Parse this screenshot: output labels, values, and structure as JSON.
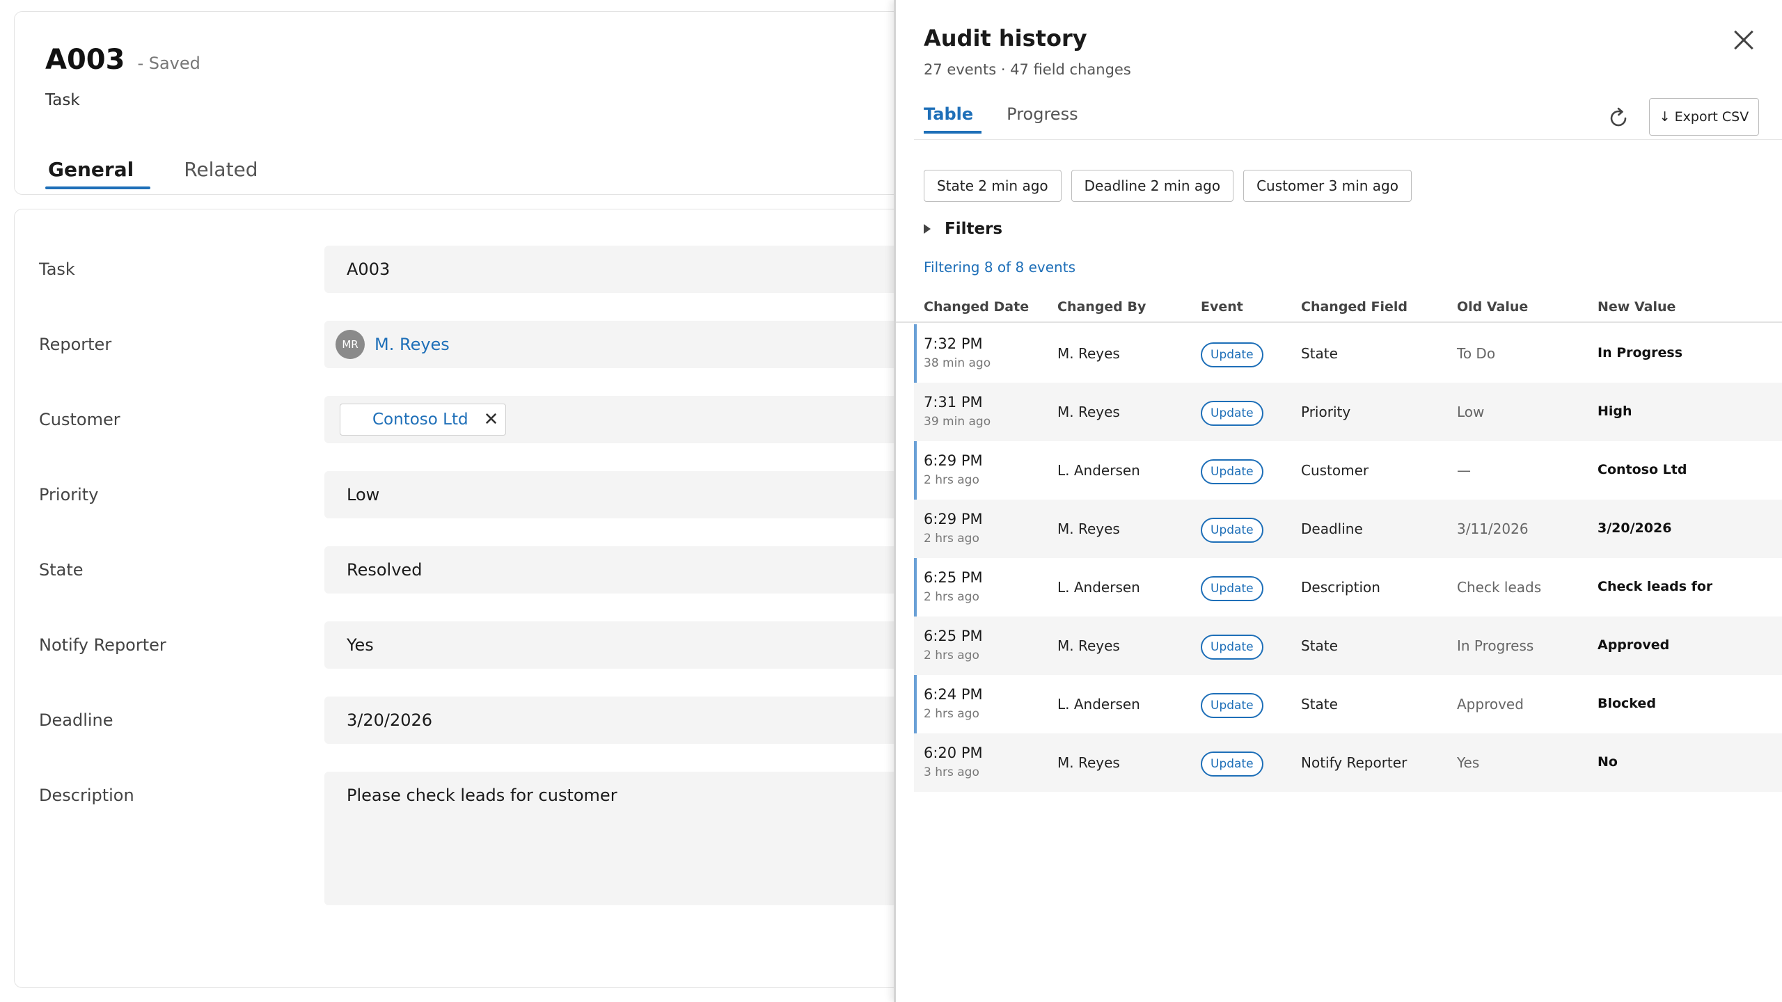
{
  "record": {
    "title": "A003",
    "status": "- Saved",
    "type": "Task",
    "tabs": [
      {
        "label": "General",
        "active": true
      },
      {
        "label": "Related",
        "active": false
      }
    ]
  },
  "form": {
    "fields": [
      {
        "label": "Task",
        "value": "A003"
      },
      {
        "label": "Reporter",
        "value": "M. Reyes",
        "avatar_initials": "MR"
      },
      {
        "label": "Customer",
        "value": "Contoso Ltd"
      },
      {
        "label": "Priority",
        "value": "Low"
      },
      {
        "label": "State",
        "value": "Resolved"
      },
      {
        "label": "Notify Reporter",
        "value": "Yes"
      },
      {
        "label": "Deadline",
        "value": "3/20/2026"
      },
      {
        "label": "Description",
        "value": "Please check leads for customer"
      }
    ]
  },
  "panel": {
    "title": "Audit history",
    "subtitle": "27 events · 47 field changes",
    "tabs": [
      {
        "label": "Table",
        "active": true
      },
      {
        "label": "Progress",
        "active": false
      }
    ],
    "export_label": "Export CSV",
    "chips": [
      "State 2 min ago",
      "Deadline 2 min ago",
      "Customer 3 min ago"
    ],
    "filters_label": "Filters",
    "filter_count": "Filtering 8 of 8 events",
    "columns": [
      "Changed Date",
      "Changed By",
      "Event",
      "Changed Field",
      "Old Value",
      "New Value"
    ],
    "rows": [
      {
        "time": "7:32 PM",
        "ago": "38 min ago",
        "by": "M. Reyes",
        "event": "Update",
        "field": "State",
        "old": "To Do",
        "new": "In Progress"
      },
      {
        "time": "7:31 PM",
        "ago": "39 min ago",
        "by": "M. Reyes",
        "event": "Update",
        "field": "Priority",
        "old": "Low",
        "new": "High"
      },
      {
        "time": "6:29 PM",
        "ago": "2 hrs ago",
        "by": "L. Andersen",
        "event": "Update",
        "field": "Customer",
        "old": "—",
        "new": "Contoso Ltd"
      },
      {
        "time": "6:29 PM",
        "ago": "2 hrs ago",
        "by": "M. Reyes",
        "event": "Update",
        "field": "Deadline",
        "old": "3/11/2026",
        "new": "3/20/2026"
      },
      {
        "time": "6:25 PM",
        "ago": "2 hrs ago",
        "by": "L. Andersen",
        "event": "Update",
        "field": "Description",
        "old": "Check leads",
        "new": "Check leads for"
      },
      {
        "time": "6:25 PM",
        "ago": "2 hrs ago",
        "by": "M. Reyes",
        "event": "Update",
        "field": "State",
        "old": "In Progress",
        "new": "Approved"
      },
      {
        "time": "6:24 PM",
        "ago": "2 hrs ago",
        "by": "L. Andersen",
        "event": "Update",
        "field": "State",
        "old": "Approved",
        "new": "Blocked"
      },
      {
        "time": "6:20 PM",
        "ago": "3 hrs ago",
        "by": "M. Reyes",
        "event": "Update",
        "field": "Notify Reporter",
        "old": "Yes",
        "new": "No"
      }
    ]
  },
  "colors": {
    "accent": "#1e6fb8",
    "row_marker": "#6aa0d6",
    "field_bg": "#f4f4f4"
  }
}
